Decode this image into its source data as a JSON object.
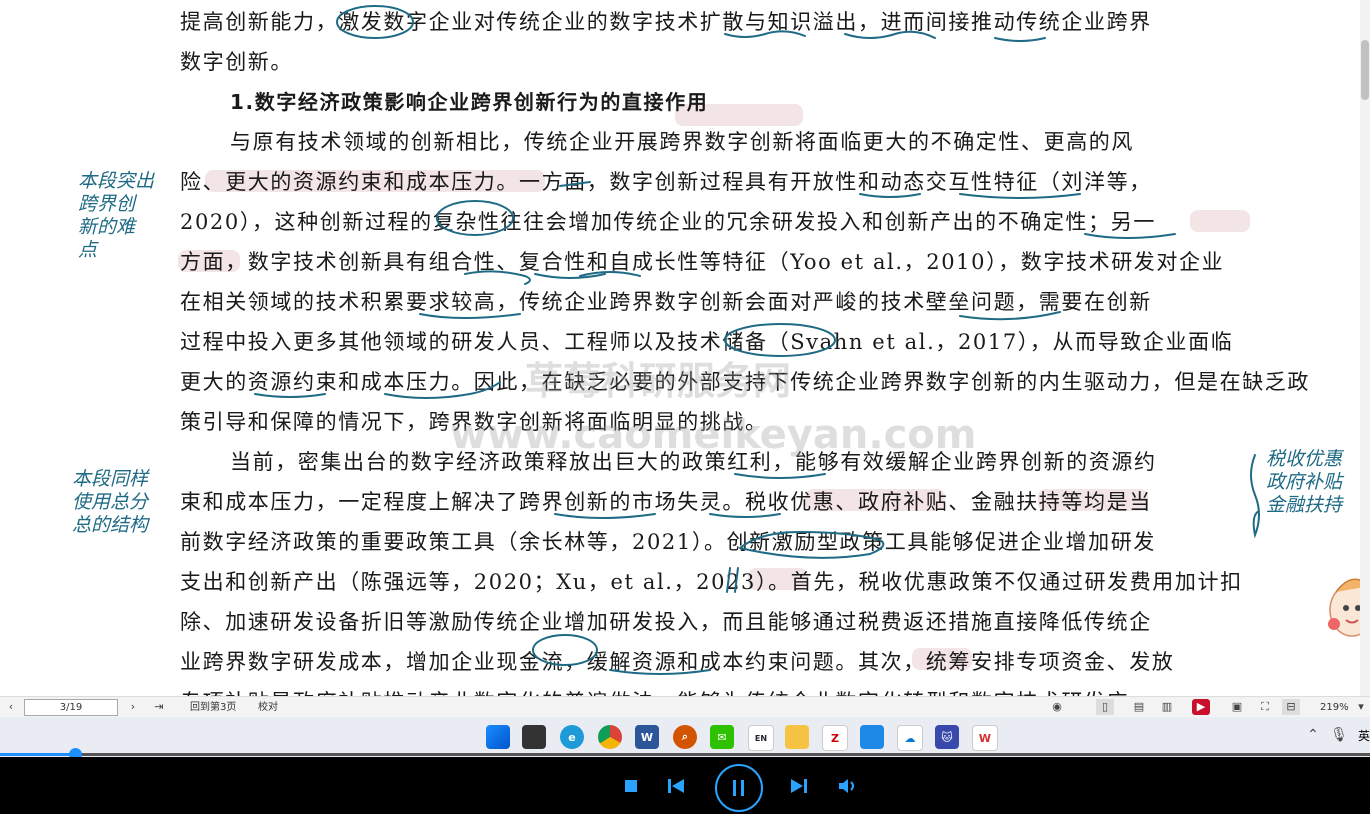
{
  "document": {
    "lines": [
      "提高创新能力，激发数字企业对传统企业的数字技术扩散与知识溢出，进而间接推动传统企业跨界",
      "数字创新。",
      "1.数字经济政策影响企业跨界创新行为的直接作用",
      "与原有技术领域的创新相比，传统企业开展跨界数字创新将面临更大的不确定性、更高的风",
      "险、更大的资源约束和成本压力。一方面，数字创新过程具有开放性和动态交互性特征（刘洋等，",
      "2020），这种创新过程的复杂性往往会增加传统企业的冗余研发投入和创新产出的不确定性；另一",
      "方面，数字技术创新具有组合性、复合性和自成长性等特征（Yoo et al.，2010），数字技术研发对企业",
      "在相关领域的技术积累要求较高，传统企业跨界数字创新会面对严峻的技术壁垒问题，需要在创新",
      "过程中投入更多其他领域的研发人员、工程师以及技术储备（Svahn et al.，2017），从而导致企业面临",
      "更大的资源约束和成本压力。因此，在缺乏必要的外部支持下传统企业跨界数字创新的内生驱动力，但是在缺乏政",
      "策引导和保障的情况下，跨界数字创新将面临明显的挑战。",
      "当前，密集出台的数字经济政策释放出巨大的政策红利，能够有效缓解企业跨界创新的资源约",
      "束和成本压力，一定程度上解决了跨界创新的市场失灵。税收优惠、政府补贴、金融扶持等均是当",
      "前数字经济政策的重要政策工具（余长林等，2021）。创新激励型政策工具能够促进企业增加研发",
      "支出和创新产出（陈强远等，2020；Xu，et al.，2023）。首先，税收优惠政策不仅通过研发费用加计扣",
      "除、加速研发设备折旧等激励传统企业增加研发投入，而且能够通过税费返还措施直接降低传统企",
      "业跨界数字研发成本，增加企业现金流，缓解资源和成本约束问题。其次，统筹安排专项资金、发放",
      "专项补贴是政府补贴推动产业数字化的普遍做法，能够为传统企业数字化转型和数字技术研发应"
    ]
  },
  "annotations": {
    "left_note_1": [
      "本段突出",
      "跨界创",
      "新的难",
      "点"
    ],
    "left_note_2": [
      "本段同样",
      "使用总分",
      "总的结构"
    ],
    "right_note": [
      "税收优惠",
      "政府补贴",
      "金融扶持"
    ]
  },
  "watermark": {
    "line1": "草莓科研服务网",
    "line2": "www.caomeikeyan.com"
  },
  "statusbar": {
    "page_indicator": "3/19",
    "back_to_page": "回到第3页",
    "proofread": "校对",
    "zoom": "219%",
    "lang": "英"
  },
  "taskbar": {
    "icons": [
      "windows-start",
      "task-view",
      "edge",
      "chrome",
      "word",
      "search-app",
      "wechat",
      "eudic",
      "file-explorer",
      "zotero",
      "notes",
      "onedrive",
      "cat-app",
      "wps"
    ]
  },
  "player": {
    "progress": 0.055
  },
  "colors": {
    "ink": "#1f6a85",
    "highlight": "#f1dfe2",
    "progress": "#1e90ff"
  }
}
